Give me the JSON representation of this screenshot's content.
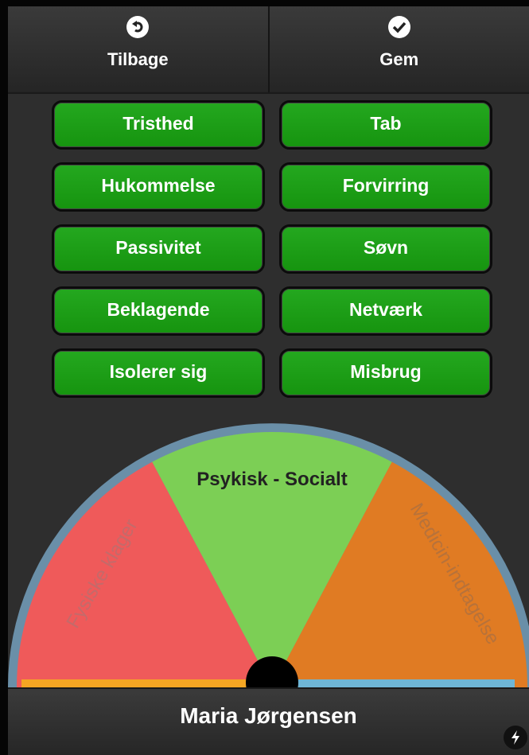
{
  "toolbar": {
    "back_label": "Tilbage",
    "save_label": "Gem",
    "back_icon": "undo-icon",
    "save_icon": "check-icon"
  },
  "symptoms": [
    {
      "label": "Tristhed"
    },
    {
      "label": "Tab"
    },
    {
      "label": "Hukommelse"
    },
    {
      "label": "Forvirring"
    },
    {
      "label": "Passivitet"
    },
    {
      "label": "Søvn"
    },
    {
      "label": "Beklagende"
    },
    {
      "label": "Netværk"
    },
    {
      "label": "Isolerer sig"
    },
    {
      "label": "Misbrug"
    }
  ],
  "dial": {
    "left_label": "Fysiske klager",
    "center_label": "Psykisk - Socialt",
    "right_label": "Medicin-indtagelse",
    "colors": {
      "left": "#ef5a5a",
      "center": "#7ccf55",
      "right": "#e07b23",
      "rim": "#6a8fa8",
      "base_left": "#f5a623",
      "base_right": "#6fb6d6"
    }
  },
  "footer": {
    "patient_name": "Maria Jørgensen",
    "bolt_icon": "bolt-icon"
  },
  "colors": {
    "button_green": "#1ea419",
    "background": "#2e2e2e"
  }
}
